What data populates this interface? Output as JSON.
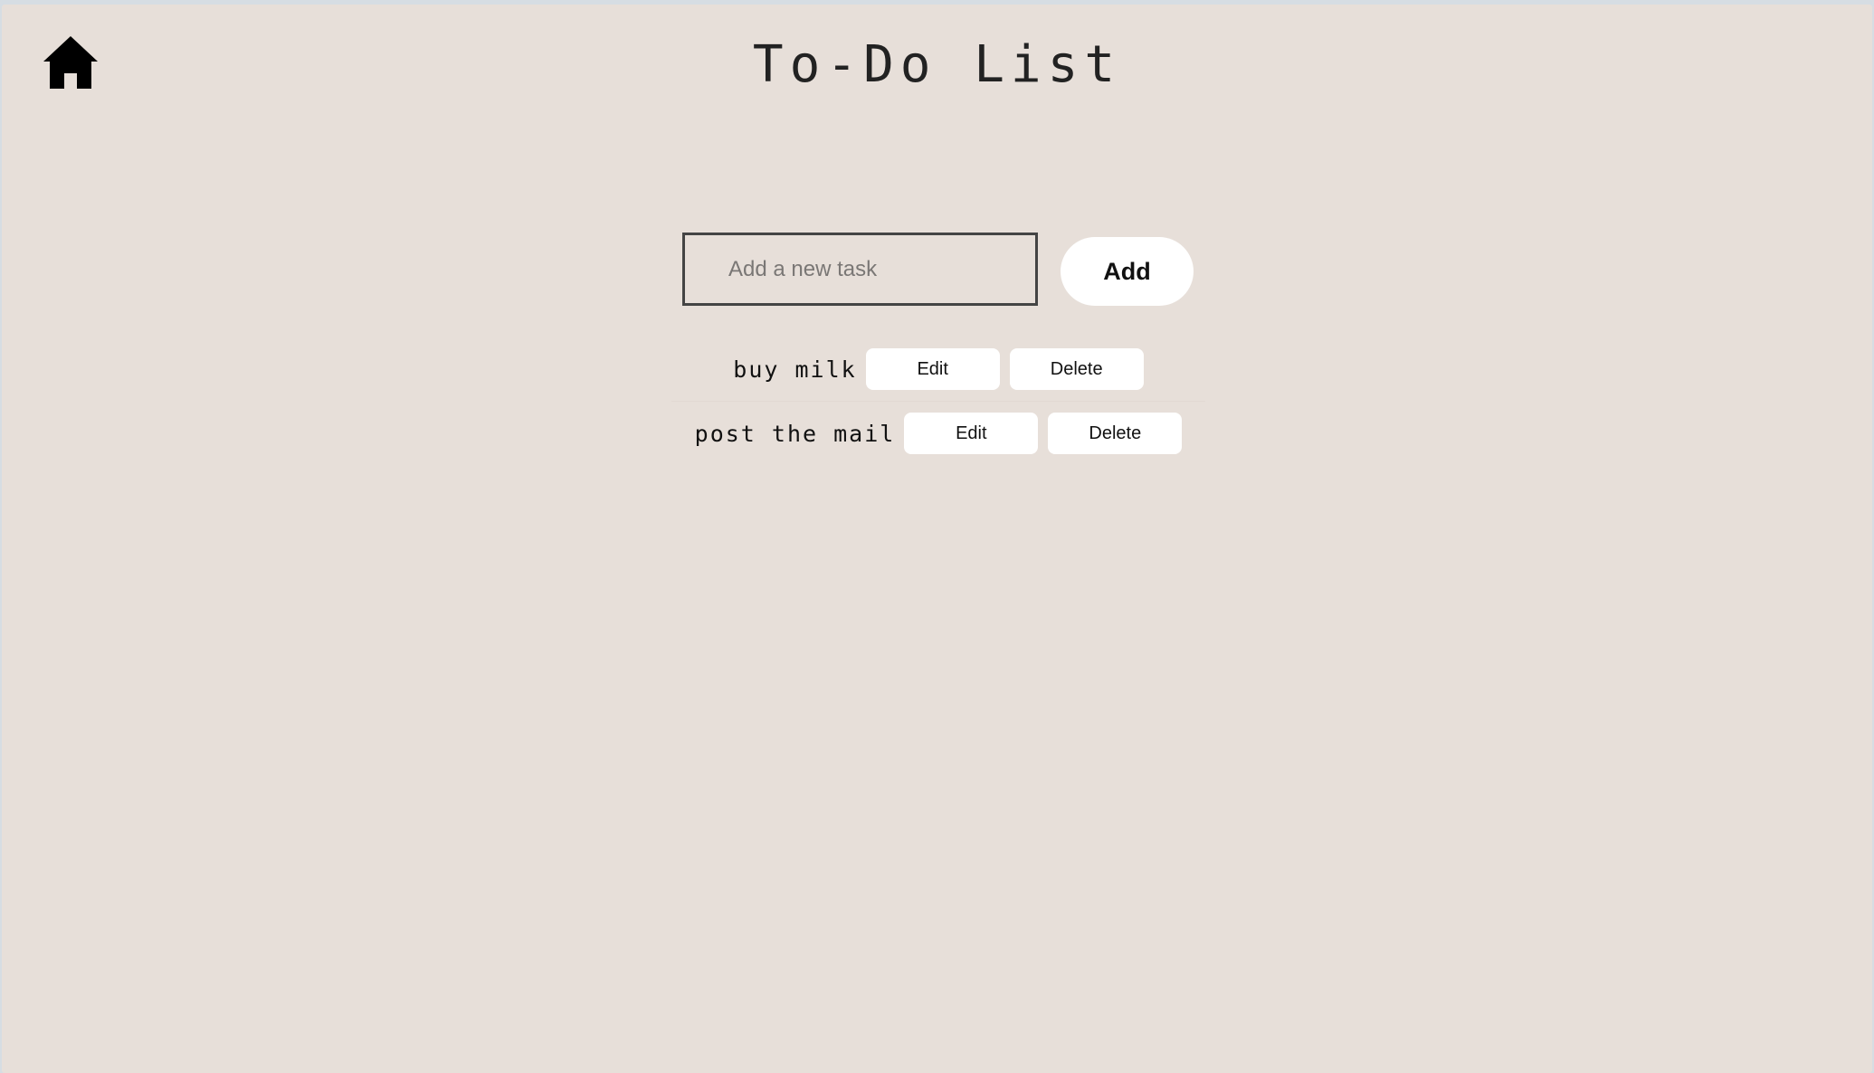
{
  "header": {
    "home_icon": "home-icon",
    "title": "To-Do List"
  },
  "new_task": {
    "placeholder": "Add a new task",
    "value": "",
    "add_label": "Add"
  },
  "tasks": [
    {
      "text": "buy milk",
      "edit_label": "Edit",
      "delete_label": "Delete"
    },
    {
      "text": "post the mail",
      "edit_label": "Edit",
      "delete_label": "Delete"
    }
  ],
  "colors": {
    "background": "#e7dfd9",
    "button": "#ffffff",
    "text": "#111111"
  }
}
